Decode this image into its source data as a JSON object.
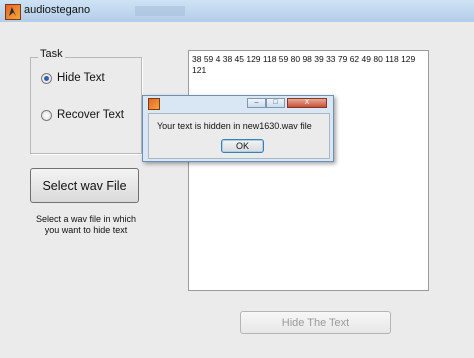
{
  "window": {
    "title": "audiostegano",
    "icon": "matlab-icon"
  },
  "task_panel": {
    "legend": "Task",
    "options": [
      {
        "label": "Hide Text",
        "checked": true
      },
      {
        "label": "Recover Text",
        "checked": false
      }
    ]
  },
  "select_button": {
    "label": "Select wav File"
  },
  "hint": {
    "line1": "Select a wav file in which",
    "line2": "you want to hide text"
  },
  "text_area": {
    "value": "38 59 4 38 45 129 118 59 80 98 39 33 79 62 49 80 118 129 121"
  },
  "hide_button": {
    "label": "Hide The Text",
    "enabled": false
  },
  "dialog": {
    "message": "Your text is hidden in  new1630.wav file",
    "ok_label": "OK",
    "close_label": "X"
  },
  "colors": {
    "titlebar": "#b3cde8",
    "window_bg": "#ebebeb",
    "dialog_frame": "#d9e6f3",
    "radio_dot": "#2f5fae"
  }
}
